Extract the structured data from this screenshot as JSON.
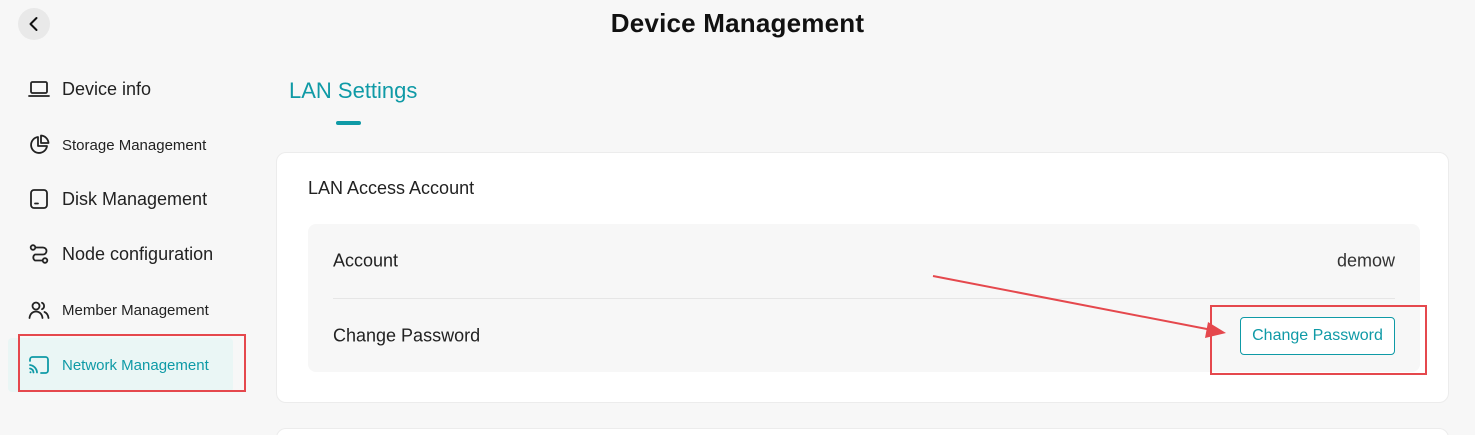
{
  "header": {
    "title": "Device Management",
    "back_icon": "chevron-left-icon"
  },
  "sidebar": {
    "items": [
      {
        "label": "Device info",
        "icon": "laptop-icon"
      },
      {
        "label": "Storage Management",
        "icon": "pie-chart-icon"
      },
      {
        "label": "Disk Management",
        "icon": "disk-icon"
      },
      {
        "label": "Node configuration",
        "icon": "route-icon"
      },
      {
        "label": "Member Management",
        "icon": "users-icon"
      },
      {
        "label": "Network Management",
        "icon": "cast-icon",
        "active": true
      }
    ]
  },
  "tabs": [
    {
      "label": "LAN Settings",
      "active": true
    }
  ],
  "lan_card": {
    "title": "LAN Access Account",
    "rows": [
      {
        "label": "Account",
        "value": "demow"
      },
      {
        "label": "Change Password",
        "button_label": "Change Password"
      }
    ]
  },
  "colors": {
    "accent": "#0f9aa6",
    "annotation": "#e5484d",
    "active_bg": "#eaf6f5"
  }
}
